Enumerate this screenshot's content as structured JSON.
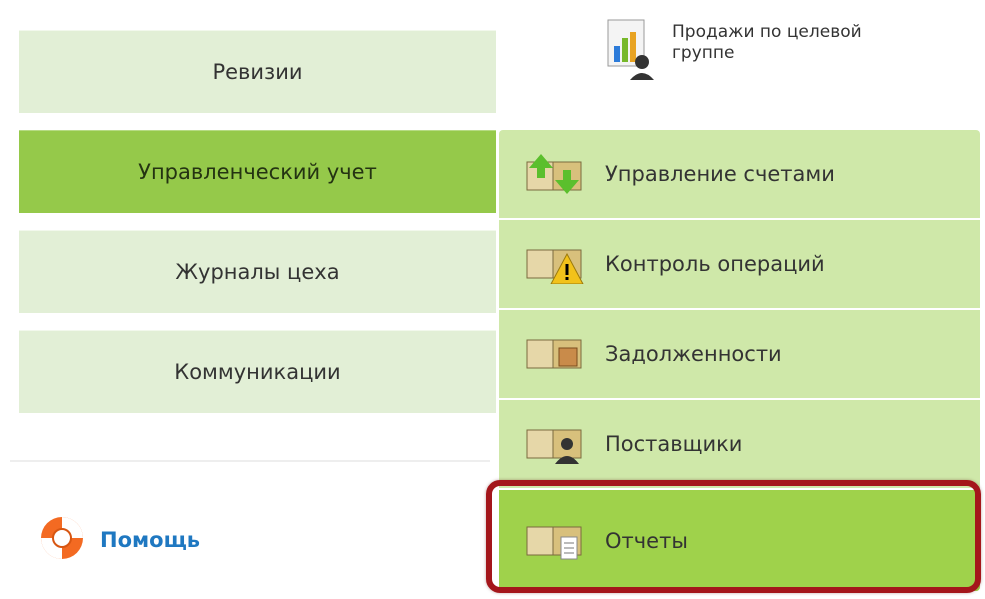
{
  "nav": {
    "items": [
      {
        "label": "Ревизии"
      },
      {
        "label": "Управленческий учет"
      },
      {
        "label": "Журналы цеха"
      },
      {
        "label": "Коммуникации"
      }
    ]
  },
  "help": {
    "label": "Помощь",
    "icon": "lifebuoy-icon"
  },
  "top_report": {
    "label_line1": "Продажи по целевой",
    "label_line2": "группе",
    "icon": "sales-report-icon"
  },
  "submenu": {
    "items": [
      {
        "label": "Управление счетами",
        "icon": "accounts-management-icon"
      },
      {
        "label": "Контроль операций",
        "icon": "operations-control-icon"
      },
      {
        "label": "Задолженности",
        "icon": "debts-icon"
      },
      {
        "label": "Поставщики",
        "icon": "suppliers-icon"
      },
      {
        "label": "Отчеты",
        "icon": "reports-icon"
      }
    ]
  },
  "colors": {
    "accent": "#95c94a",
    "light": "#e2efd6",
    "submenu": "#cfe8a9",
    "highlight": "#a4161b",
    "help": "#1f78c1"
  }
}
